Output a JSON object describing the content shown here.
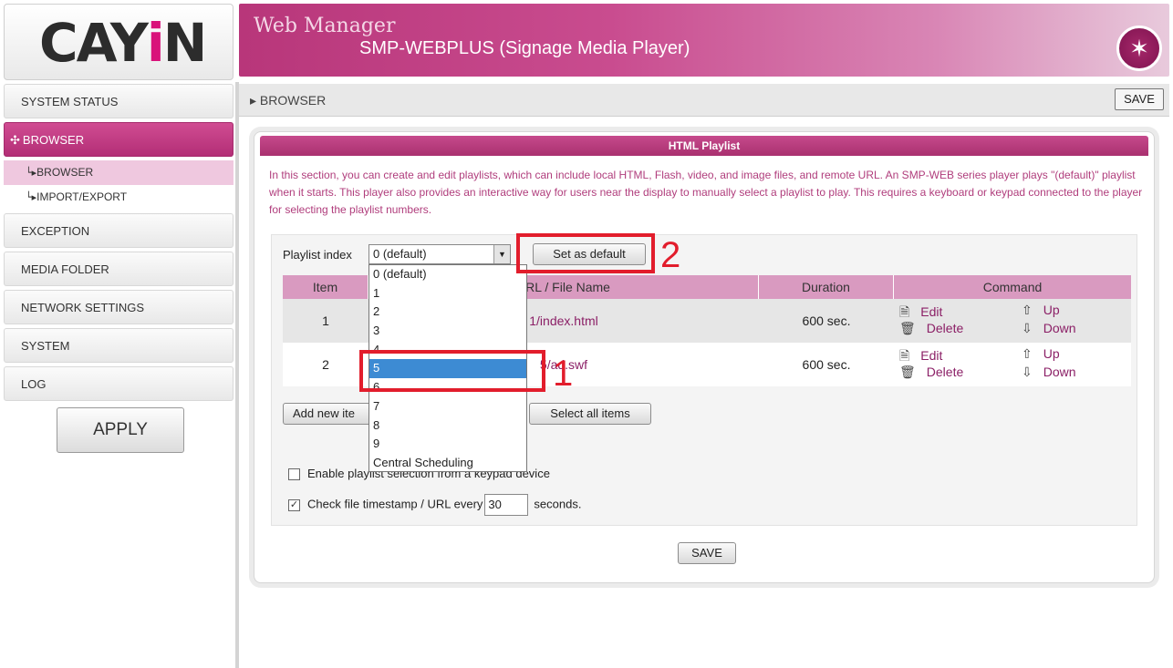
{
  "logo": {
    "text_prefix": "CA",
    "text_y": "Y",
    "text_i": "i",
    "text_n": "N"
  },
  "header": {
    "app_name": "Web Manager",
    "model": "SMP-WEBPLUS (Signage Media Player)",
    "wand_icon": "wand-icon"
  },
  "sidebar": {
    "items": [
      {
        "label": "SYSTEM STATUS"
      },
      {
        "label": "BROWSER",
        "active": true,
        "icon": "star-icon"
      },
      {
        "label": "EXCEPTION"
      },
      {
        "label": "MEDIA FOLDER"
      },
      {
        "label": "NETWORK SETTINGS"
      },
      {
        "label": "SYSTEM"
      },
      {
        "label": "LOG"
      }
    ],
    "sub_items": [
      {
        "label": "BROWSER",
        "active": true
      },
      {
        "label": "IMPORT/EXPORT"
      }
    ],
    "apply_label": "APPLY"
  },
  "breadcrumb": {
    "text": "BROWSER",
    "save_label": "SAVE"
  },
  "panel": {
    "title": "HTML Playlist",
    "intro": "In this section, you can create and edit playlists, which can include local HTML, Flash, video, and image files, and remote URL. An SMP-WEB series player plays \"(default)\" playlist when it starts. This player also provides an interactive way for users near the display to manually select a playlist to play. This requires a keyboard or keypad connected to the player for selecting the playlist numbers.",
    "playlist_index_label": "Playlist index",
    "playlist_index_value": "0 (default)",
    "set_default_label": "Set as default",
    "columns": [
      "Item",
      "URL / File Name",
      "Duration",
      "Command"
    ],
    "rows": [
      {
        "item": "1",
        "name": "1/index.html",
        "duration": "600 sec.",
        "edit": "Edit",
        "delete": "Delete",
        "up": "Up",
        "down": "Down"
      },
      {
        "item": "2",
        "name": "5/ad.swf",
        "duration": "600 sec.",
        "edit": "Edit",
        "delete": "Delete",
        "up": "Up",
        "down": "Down"
      }
    ],
    "add_new_label": "Add new ite",
    "select_all_label": "Select all items",
    "enable_keypad_label": "Enable playlist selection from a keypad device",
    "enable_keypad_checked": false,
    "check_timestamp_label": "Check file timestamp / URL every",
    "check_timestamp_checked": true,
    "interval_value": "30",
    "interval_unit": "seconds.",
    "save_label": "SAVE"
  },
  "dropdown": {
    "options": [
      "0 (default)",
      "1",
      "2",
      "3",
      "4",
      "5",
      "6",
      "7",
      "8",
      "9",
      "Central Scheduling"
    ],
    "selected": "5"
  },
  "callouts": {
    "one": "1",
    "two": "2",
    "accent_color": "#e21d2c"
  }
}
